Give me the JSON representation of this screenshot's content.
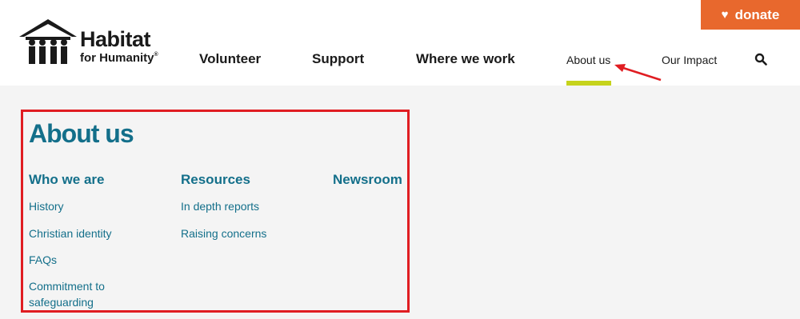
{
  "logo": {
    "line1": "Habitat",
    "line2": "for Humanity",
    "reg": "®"
  },
  "donate": {
    "label": "donate",
    "icon": "heart-icon"
  },
  "nav": {
    "volunteer": "Volunteer",
    "support": "Support",
    "where_we_work": "Where we work",
    "about_us": "About us",
    "our_impact": "Our Impact",
    "search_icon": "search-icon"
  },
  "panel": {
    "title": "About us",
    "columns": [
      {
        "heading": "Who we are",
        "links": [
          "History",
          "Christian identity",
          "FAQs",
          "Commitment to",
          "safeguarding"
        ]
      },
      {
        "heading": "Resources",
        "links": [
          "In depth reports",
          "Raising concerns"
        ]
      },
      {
        "heading": "Newsroom",
        "links": []
      }
    ]
  },
  "colors": {
    "accent": "#136f8a",
    "donate": "#e8682d",
    "active_bar": "#c6d31c",
    "highlight_box": "#e01d22"
  }
}
